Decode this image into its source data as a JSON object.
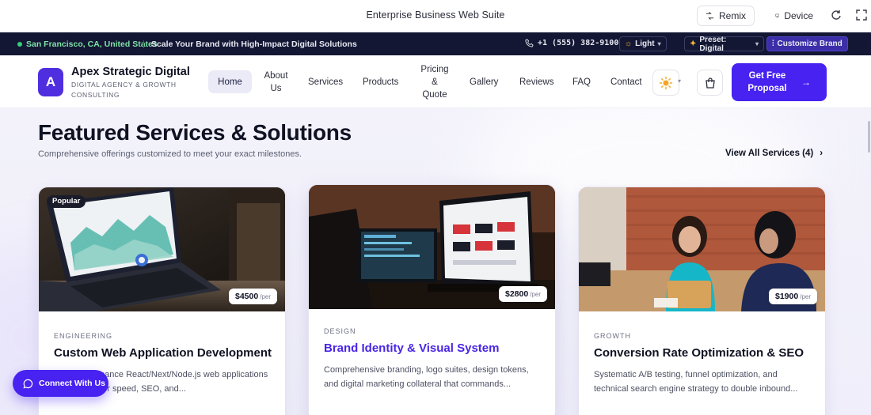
{
  "window": {
    "title": "Enterprise Business Web Suite",
    "remix_label": "Remix",
    "device_label": "Device",
    "icons": [
      "remix-icon",
      "device-icon",
      "refresh-icon",
      "expand-icon"
    ]
  },
  "topbar": {
    "location": "San Francisco, CA, United States",
    "tagline": "Scale Your Brand with High-Impact Digital Solutions",
    "phone": "+1 (555) 382-9100",
    "theme_label": "Light",
    "preset_label": "Preset: Digital",
    "customize_label": "Customize Brand",
    "colors": {
      "background": "#141733",
      "location": "#7fe3a6",
      "customize": "#3b2ea8"
    }
  },
  "nav": {
    "logo_letter": "A",
    "brand_name": "Apex Strategic Digital",
    "brand_sub": "DIGITAL AGENCY & GROWTH CONSULTING",
    "items": {
      "home": "Home",
      "about": "About Us",
      "services": "Services",
      "products": "Products",
      "pricing": "Pricing & Quote",
      "gallery": "Gallery",
      "reviews": "Reviews",
      "faq": "FAQ",
      "contact": "Contact"
    },
    "active": "Home",
    "cta_label": "Get Free Proposal",
    "accent": "#4722f0"
  },
  "section": {
    "title": "Featured Services & Solutions",
    "subtitle": "Comprehensive offerings customized to meet your exact milestones.",
    "view_all": "View All Services (4)"
  },
  "cards": [
    {
      "badge": "Popular",
      "price": "$4500",
      "per": "/per",
      "category": "ENGINEERING",
      "title": "Custom Web Application Development",
      "desc": "High-performance React/Next/Node.js web applications engineered for speed, SEO, and..."
    },
    {
      "price": "$2800",
      "per": "/per",
      "category": "DESIGN",
      "title": "Brand Identity & Visual System",
      "desc": "Comprehensive branding, logo suites, design tokens, and digital marketing collateral that commands..."
    },
    {
      "price": "$1900",
      "per": "/per",
      "category": "GROWTH",
      "title": "Conversion Rate Optimization & SEO",
      "desc": "Systematic A/B testing, funnel optimization, and technical search engine strategy to double inbound..."
    }
  ],
  "chat": {
    "label": "Connect With Us"
  }
}
